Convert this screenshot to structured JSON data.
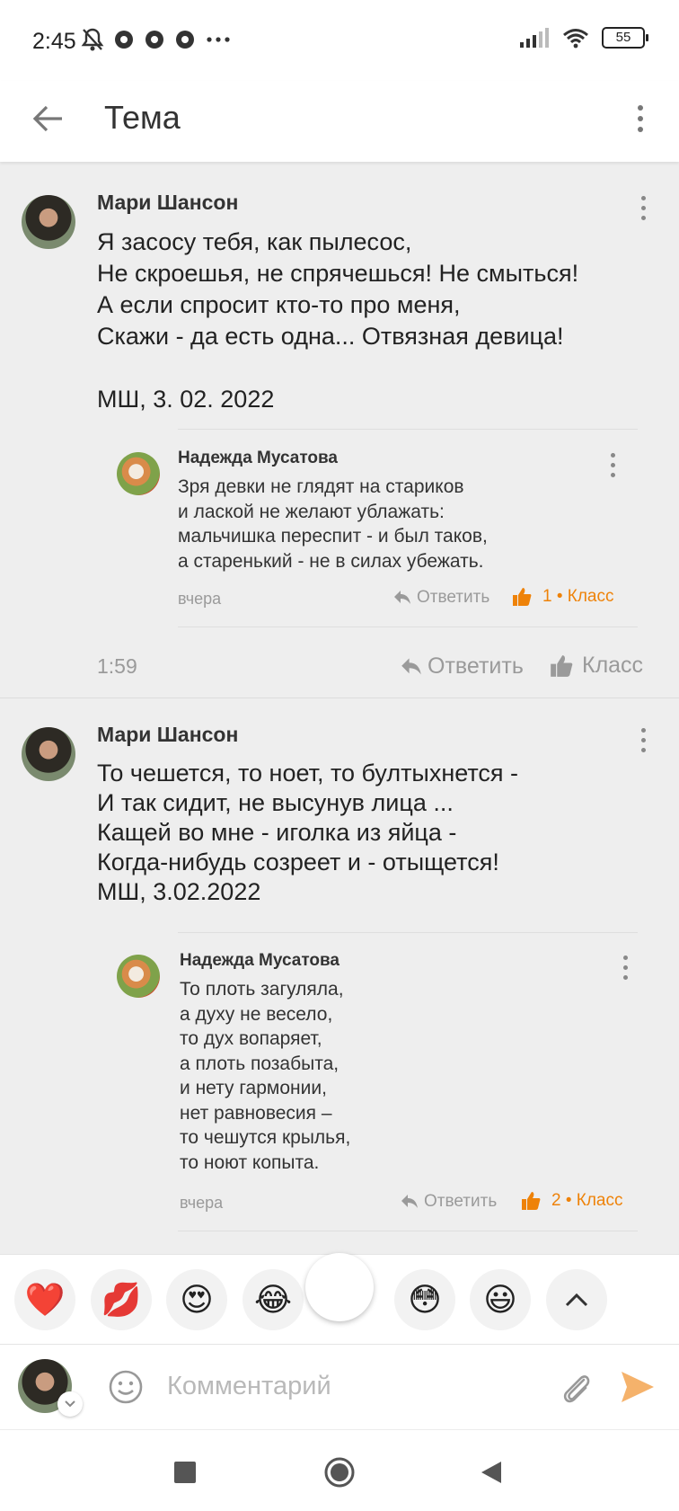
{
  "status": {
    "time": "2:45",
    "battery": "55"
  },
  "header": {
    "title": "Тема"
  },
  "posts": [
    {
      "author": "Мари Шансон",
      "text": "Я засосу тебя, как пылесос,\nНе скроешья, не спрячешься! Не смыться!\nА если спросит кто-то про меня,\nСкажи -  да есть одна... Отвязная девица!\n\nМШ, 3. 02. 2022",
      "time": "1:59",
      "reply_label": "Ответить",
      "like_label": "Класс",
      "reply": {
        "author": "Надежда Мусатова",
        "text": "Зря девки не глядят на стариков\nи лаской не желают ублажать:\nмальчишка переспит - и был таков,\nа старенький - не в силах убежать.",
        "time": "вчера",
        "reply_label": "Ответить",
        "likes": "1 • Класс"
      }
    },
    {
      "author": "Мари Шансон",
      "text": "То чешется, то ноет, то бултыхнется -\nИ так сидит, не высунув лица ...\nКащей во мне - иголка из яйца -\nКогда-нибудь созреет и - отыщется!\nМШ, 3.02.2022",
      "reply": {
        "author": "Надежда Мусатова",
        "text": "То плоть загуляла,\nа духу не весело,\nто дух вопаряет,\nа плоть позабыта,\nи нету гармонии,\nнет равновесия –\nто чешутся крылья,\nто ноют копыта.",
        "time": "вчера",
        "reply_label": "Ответить",
        "likes": "2 • Класс"
      }
    }
  ],
  "reactions": [
    "❤️",
    "💋",
    "😍",
    "😂",
    "😳",
    "😃"
  ],
  "composer": {
    "placeholder": "Комментарий"
  },
  "colors": {
    "accent": "#ee8208",
    "send": "#f5b26b",
    "background": "#eeeeee"
  }
}
